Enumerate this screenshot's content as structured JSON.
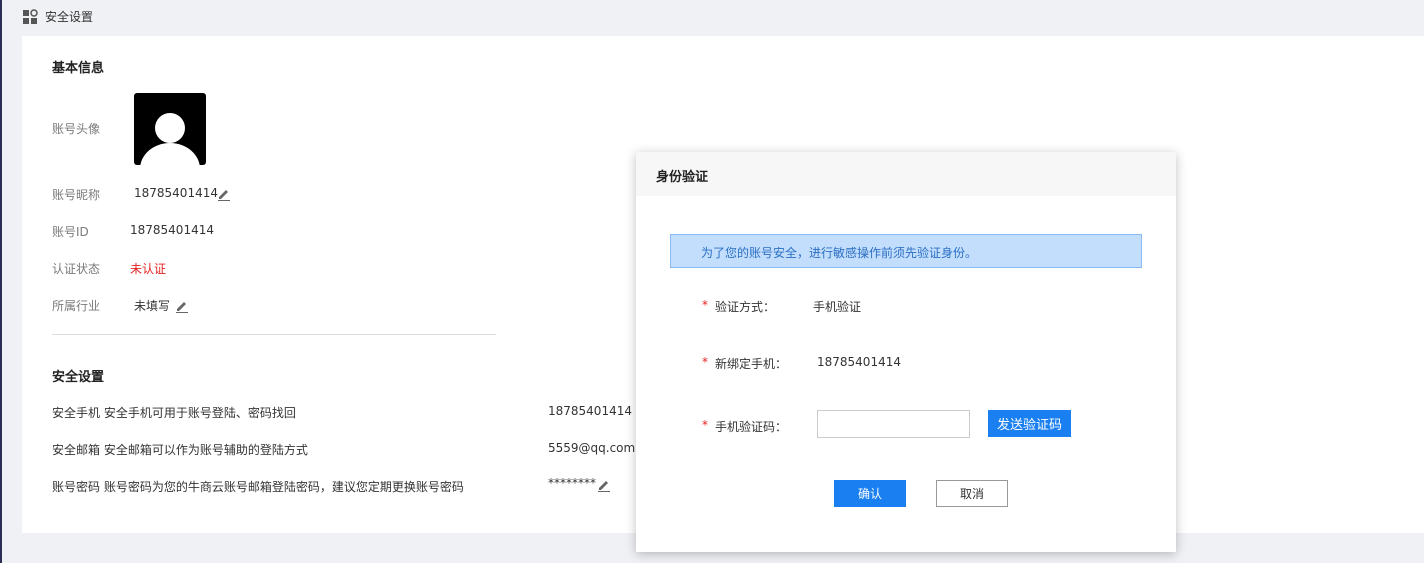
{
  "header": {
    "title": "安全设置",
    "icon": "grid-settings-icon"
  },
  "basic": {
    "section_title": "基本信息",
    "avatar_label": "账号头像",
    "nickname_label": "账号昵称",
    "nickname_value": "18785401414",
    "id_label": "账号ID",
    "id_value": "18785401414",
    "verify_label": "认证状态",
    "verify_value": "未认证",
    "industry_label": "所属行业",
    "industry_value": "未填写"
  },
  "security": {
    "section_title": "安全设置",
    "rows": [
      {
        "label": "安全手机 安全手机可用于账号登陆、密码找回",
        "value": "18785401414"
      },
      {
        "label": "安全邮箱 安全邮箱可以作为账号辅助的登陆方式",
        "value": "5559@qq.com"
      },
      {
        "label": "账号密码 账号密码为您的牛商云账号邮箱登陆密码，建议您定期更换账号密码",
        "value": "********"
      }
    ]
  },
  "modal": {
    "title": "身份验证",
    "notice": "为了您的账号安全，进行敏感操作前须先验证身份。",
    "method_label": "验证方式：",
    "method_value": "手机验证",
    "phone_label": "新绑定手机：",
    "phone_value": "18785401414",
    "code_label": "手机验证码：",
    "code_value": "",
    "send_label": "发送验证码",
    "confirm_label": "确认",
    "cancel_label": "取消",
    "required_mark": "*"
  },
  "colors": {
    "accent": "#1a7ff0",
    "danger": "#e62222",
    "notice_bg": "#c3defc"
  }
}
